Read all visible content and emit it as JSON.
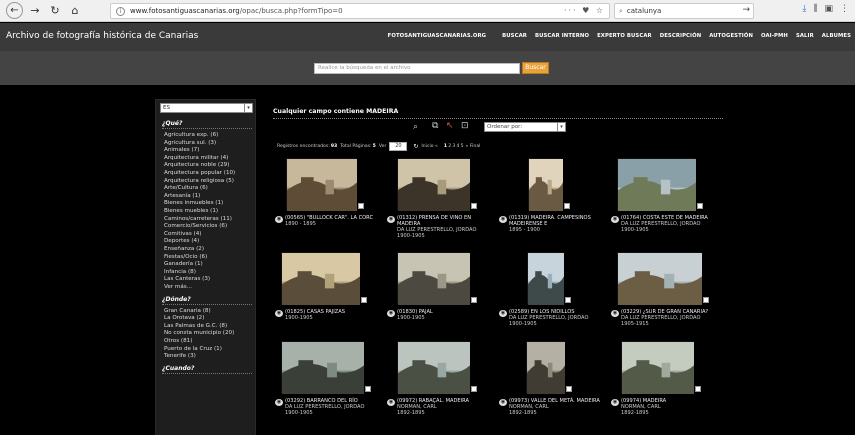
{
  "browser": {
    "url_domain": "www.fotosantiguascanarias.org",
    "url_path": "/opac/busca.php?formTipo=0",
    "url_prefix": "",
    "url_actions": "··· ♥ ☆",
    "search_value": "catalunya"
  },
  "header": {
    "site_title": "Archivo de fotografía histórica de Canarias",
    "nav": [
      "FOTOSANTIGUASCANARIAS.ORG",
      "BUSCAR",
      "BUSCAR INTERNO",
      "EXPERTO BUSCAR",
      "DESCRIPCIÓN",
      "AUTOGESTIÓN",
      "OAI-PMH",
      "SALIR",
      "ALBUMES"
    ]
  },
  "search": {
    "placeholder": "Realice la búsqueda en el archivo",
    "button": "Buscar"
  },
  "sidebar": {
    "language": "ES",
    "que_title": "¿Qué?",
    "que_items": [
      "Agricultura exp. (6)",
      "Agricultura sul. (3)",
      "Animales (7)",
      "Arquitectura militar (4)",
      "Arquitectura noble (29)",
      "Arquitectura popular (10)",
      "Arquitectura religiosa (5)",
      "Arte/Cultura (6)",
      "Artesanía (1)",
      "Bienes inmuebles (1)",
      "Bienes muebles (1)",
      "Caminos/carreteras (11)",
      "Comercio/Servicios (6)",
      "Comitivas (4)",
      "Deportes (4)",
      "Enseñanza (2)",
      "Fiestas/Ocio (6)",
      "Ganadería (1)",
      "Infancia (8)",
      "Las Canteras (3)",
      "Ver más..."
    ],
    "donde_title": "¿Dónde?",
    "donde_items": [
      "Gran Canaria (8)",
      "La Orotava (2)",
      "Las Palmas de G.C. (8)",
      "No consta municipio (20)",
      "Otros (81)",
      "Puerto de la Cruz (1)",
      "Tenerife (3)"
    ],
    "cuando_title": "¿Cuando?"
  },
  "content": {
    "heading": "Cualquier campo contiene MADEIRA",
    "order_label": "Ordenar por:",
    "stats": {
      "found_label": "Registros encontrados:",
      "found": "93",
      "pages_label": "Total Páginas:",
      "pages": "5",
      "view_label": "Ver",
      "view": "20",
      "start_label": "Inicio «",
      "pages_list": [
        "1",
        "2",
        "3",
        "4",
        "5"
      ],
      "end_label": "» Final"
    },
    "cards": [
      {
        "title": "(00565) \"BULLOCK CAR\". LA CORC",
        "author": "",
        "date": "1890 - 1895"
      },
      {
        "title": "(01312) PRENSA DE VINO EN MADEIRA",
        "author": "DA LUZ PERESTRELLO, JORDAO",
        "date": "1900-1905"
      },
      {
        "title": "(01319) MADEIRA. CAMPESINOS MADEIRENSE E",
        "author": "",
        "date": "1895 - 1900"
      },
      {
        "title": "(01764) COSTA ESTE DE MADEIRA",
        "author": "DA LUZ PERESTRELLO, JORDAO",
        "date": "1900-1905"
      },
      {
        "title": "(01825) CASAS PAJIZAS",
        "author": "",
        "date": "1900-1905"
      },
      {
        "title": "(01830) PAJAL",
        "author": "",
        "date": "1900-1905"
      },
      {
        "title": "(02589) EN LOS NIDILLOS",
        "author": "DA LUZ PERESTRELLO, JORDAO",
        "date": "1900-1905"
      },
      {
        "title": "(03229) ¿SUR DE GRAN CANARIA?",
        "author": "DA LUZ PERESTRELLO, JORDAO",
        "date": "1905-1915"
      },
      {
        "title": "(03292) BARRANCO DEL RÍO",
        "author": "DA LUZ PERESTRELLO, JORDAO",
        "date": "1900-1905"
      },
      {
        "title": "(09972) RABAÇAL. MADEIRA",
        "author": "NORMAN, CARL",
        "date": "1892-1895"
      },
      {
        "title": "(09973) VALLE DEL METÁ. MADEIRA",
        "author": "NORMAN, CARL",
        "date": "1892-1895"
      },
      {
        "title": "(09974) MADEIRA",
        "author": "NORMAN, CARL",
        "date": "1892-1895"
      }
    ]
  }
}
